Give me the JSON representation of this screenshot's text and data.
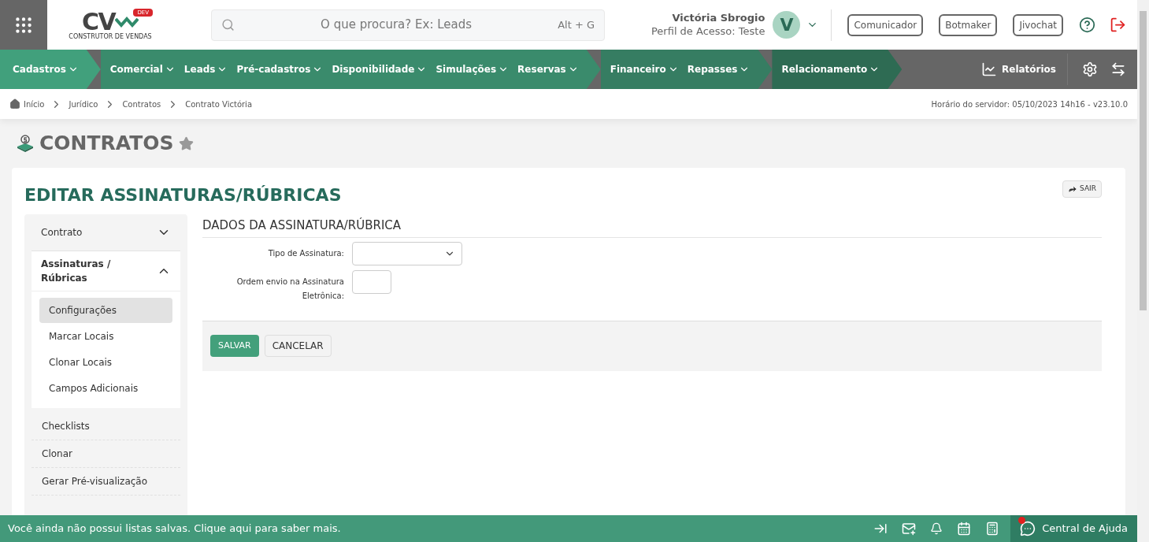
{
  "topbar": {
    "logo": {
      "letters": "CV",
      "badge": "DEV",
      "subtitle": "CONSTRUTOR DE VENDAS"
    },
    "search": {
      "placeholder": "O que procura? Ex: Leads",
      "shortcut": "Alt + G"
    },
    "user": {
      "name": "Victória Sbrogio",
      "profile": "Perfil de Acesso: Teste",
      "initial": "V"
    },
    "buttons": [
      "Comunicador",
      "Botmaker",
      "Jivochat"
    ]
  },
  "nav": {
    "groups": [
      {
        "items": [
          "Cadastros"
        ]
      },
      {
        "items": [
          "Comercial",
          "Leads",
          "Pré-cadastros",
          "Disponibilidade",
          "Simulações",
          "Reservas"
        ]
      },
      {
        "items": [
          "Financeiro",
          "Repasses"
        ]
      },
      {
        "items": [
          "Relacionamento"
        ]
      }
    ],
    "reports": "Relatórios"
  },
  "breadcrumb": {
    "items": [
      "Início",
      "Jurídico",
      "Contratos",
      "Contrato Victória"
    ],
    "server_time": "Horário do servidor: 05/10/2023 14h16 - v23.10.0"
  },
  "page_title": "CONTRATOS",
  "card": {
    "title": "EDITAR ASSINATURAS/RÚBRICAS",
    "exit": "SAIR"
  },
  "sidebar": [
    {
      "kind": "group",
      "label": "Contrato",
      "expanded": false
    },
    {
      "kind": "group",
      "label": "Assinaturas / Rúbricas",
      "expanded": true,
      "children": [
        {
          "label": "Configurações",
          "selected": true
        },
        {
          "label": "Marcar Locais",
          "selected": false
        },
        {
          "label": "Clonar Locais",
          "selected": false
        },
        {
          "label": "Campos Adicionais",
          "selected": false
        }
      ]
    },
    {
      "kind": "link",
      "label": "Checklists"
    },
    {
      "kind": "link",
      "label": "Clonar"
    },
    {
      "kind": "link",
      "label": "Gerar Pré-visualização"
    }
  ],
  "form": {
    "title": "DADOS DA ASSINATURA/RÚBRICA",
    "fields": [
      {
        "kind": "select",
        "label": "Tipo de Assinatura:"
      },
      {
        "kind": "number",
        "label": "Ordem envio na Assinatura Eletrônica:"
      }
    ],
    "save": "SALVAR",
    "cancel": "CANCELAR"
  },
  "footer": {
    "message": "Você ainda não possui listas salvas. Clique aqui para saber mais.",
    "help": "Central de Ajuda"
  }
}
